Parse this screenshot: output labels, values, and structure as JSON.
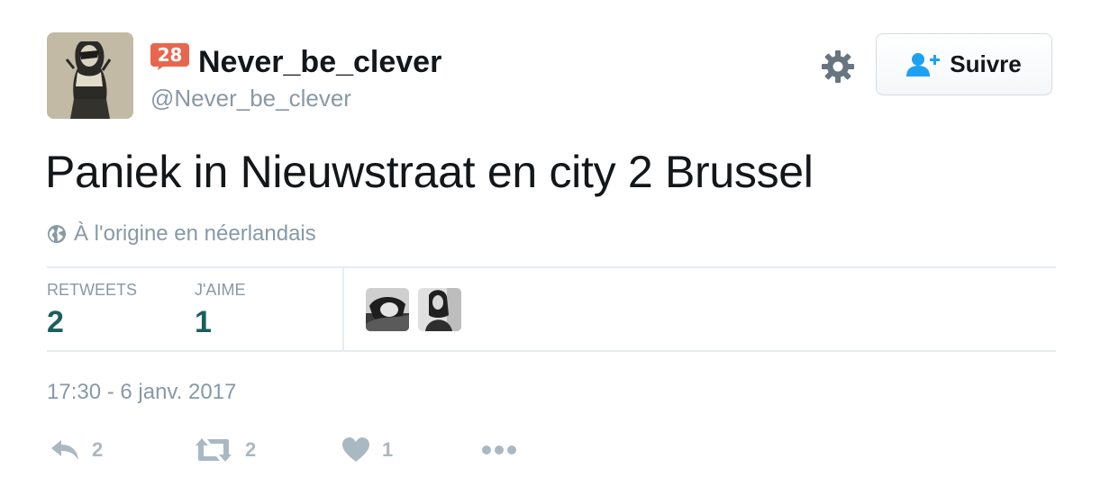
{
  "author": {
    "display_name": "Never_be_clever",
    "screen_name": "@Never_be_clever",
    "badge_count": "28",
    "avatar_icon": "avatar-image",
    "badge_color": "#e8664e"
  },
  "header": {
    "settings_icon": "gear-icon",
    "follow_label": "Suivre",
    "follow_icon": "add-user-icon",
    "follow_icon_color": "#1da1f2"
  },
  "tweet": {
    "text": "Paniek in Nieuwstraat en city 2 Brussel",
    "translation_label": "À l'origine en néerlandais",
    "translation_icon": "globe-icon",
    "timestamp": "17:30 - 6 janv. 2017"
  },
  "stats": {
    "retweets_label": "RETWEETS",
    "retweets_value": "2",
    "likes_label": "J'AIME",
    "likes_value": "1",
    "value_color": "#1c5e5e"
  },
  "actions": {
    "reply_count": "2",
    "retweet_count": "2",
    "like_count": "1",
    "icon_color": "#aab8c2"
  }
}
